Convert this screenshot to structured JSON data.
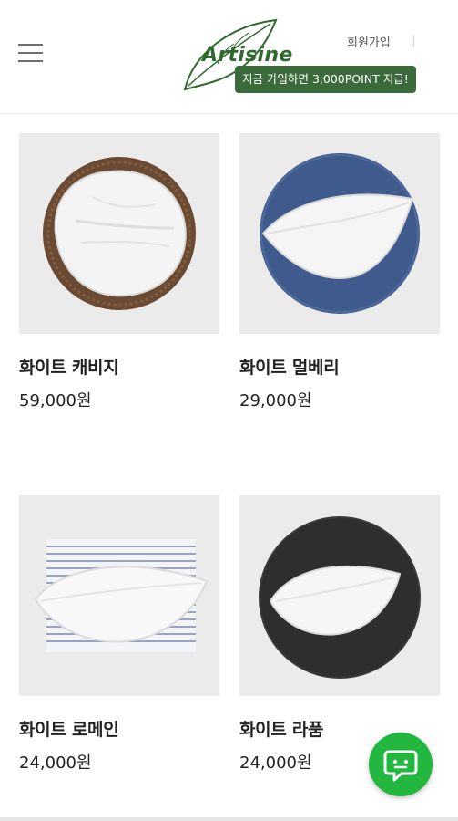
{
  "header": {
    "logo_text": "Artisine",
    "join_label": "회원가입",
    "promo_text": "지금 가입하면 3,000POINT 지급!"
  },
  "products": [
    {
      "name": "화이트 캐비지",
      "price": "59,000원"
    },
    {
      "name": "화이트 멀베리",
      "price": "29,000원"
    },
    {
      "name": "화이트 로메인",
      "price": "24,000원"
    },
    {
      "name": "화이트 라품",
      "price": "24,000원"
    }
  ],
  "colors": {
    "brand_green": "#3b6b3a",
    "chat_green": "#22b83f",
    "thumb_bg": "#ebebeb"
  },
  "icons": {
    "menu": "hamburger-icon",
    "chat": "chat-bubble-icon"
  }
}
